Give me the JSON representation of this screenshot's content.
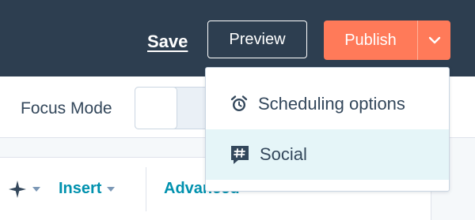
{
  "header": {
    "save_label": "Save",
    "preview_label": "Preview",
    "publish_label": "Publish"
  },
  "toolbar": {
    "focus_mode_label": "Focus Mode"
  },
  "editor_toolbar": {
    "insert_label": "Insert",
    "advanced_label": "Advanced"
  },
  "publish_menu": {
    "items": [
      {
        "label": "Scheduling options",
        "icon": "alarm-clock-icon"
      },
      {
        "label": "Social",
        "icon": "hashtag-chat-icon"
      }
    ]
  },
  "colors": {
    "header_bg": "#2d3e50",
    "publish_orange": "#ff7a59",
    "link_teal": "#0091ae",
    "text_dark": "#33475b",
    "hover_row": "#e5f5f8"
  }
}
